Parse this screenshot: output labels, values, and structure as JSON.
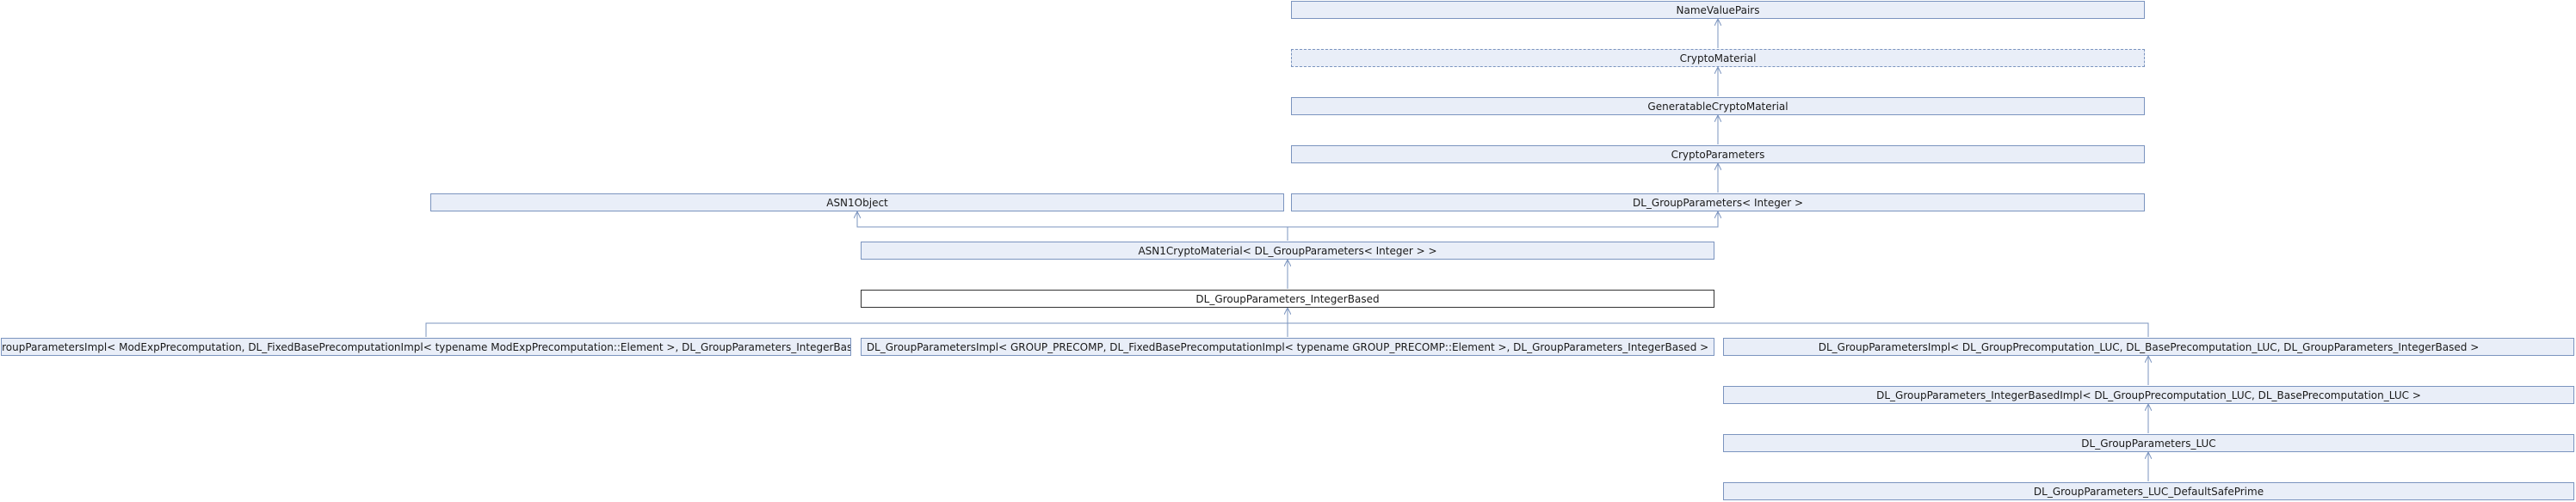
{
  "nodes": {
    "name_value_pairs": "NameValuePairs",
    "crypto_material": "CryptoMaterial",
    "generatable_crypto_material": "GeneratableCryptoMaterial",
    "crypto_parameters": "CryptoParameters",
    "asn1_object": "ASN1Object",
    "dl_group_parameters_integer": "DL_GroupParameters< Integer >",
    "asn1_crypto_material": "ASN1CryptoMaterial< DL_GroupParameters< Integer > >",
    "dl_group_parameters_integer_based": "DL_GroupParameters_IntegerBased",
    "impl_modexp": "DL_GroupParametersImpl< ModExpPrecomputation, DL_FixedBasePrecomputationImpl< typename ModExpPrecomputation::Element >, DL_GroupParameters_IntegerBased >",
    "impl_group_precomp": "DL_GroupParametersImpl< GROUP_PRECOMP, DL_FixedBasePrecomputationImpl< typename GROUP_PRECOMP::Element >, DL_GroupParameters_IntegerBased >",
    "impl_luc": "DL_GroupParametersImpl< DL_GroupPrecomputation_LUC, DL_BasePrecomputation_LUC, DL_GroupParameters_IntegerBased >",
    "integer_based_impl_luc": "DL_GroupParameters_IntegerBasedImpl< DL_GroupPrecomputation_LUC, DL_BasePrecomputation_LUC >",
    "group_parameters_luc": "DL_GroupParameters_LUC",
    "luc_default_safe_prime": "DL_GroupParameters_LUC_DefaultSafePrime"
  },
  "colors": {
    "box_fill": "#e9eef8",
    "box_border": "#7b94bf",
    "edge": "#7b94bf",
    "current_border": "#333333"
  }
}
